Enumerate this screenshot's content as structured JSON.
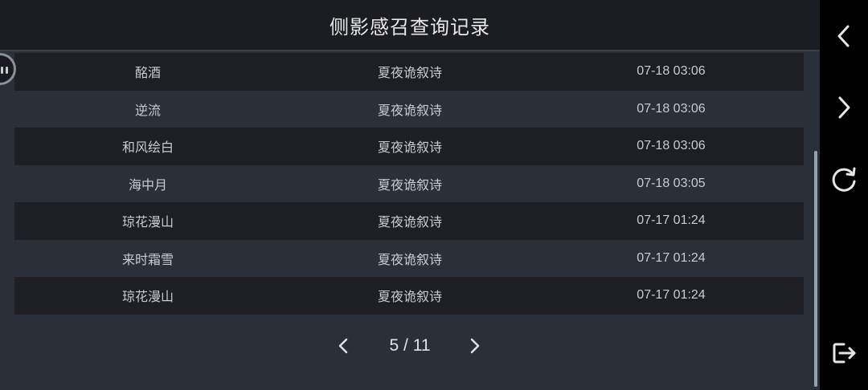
{
  "header": {
    "title": "侧影感召查询记录"
  },
  "records": [
    {
      "name": "酩酒",
      "group": "夏夜诡叙诗",
      "time": "07-18 03:06"
    },
    {
      "name": "逆流",
      "group": "夏夜诡叙诗",
      "time": "07-18 03:06"
    },
    {
      "name": "和风绘白",
      "group": "夏夜诡叙诗",
      "time": "07-18 03:06"
    },
    {
      "name": "海中月",
      "group": "夏夜诡叙诗",
      "time": "07-18 03:05"
    },
    {
      "name": "琼花漫山",
      "group": "夏夜诡叙诗",
      "time": "07-17 01:24"
    },
    {
      "name": "来时霜雪",
      "group": "夏夜诡叙诗",
      "time": "07-17 01:24"
    },
    {
      "name": "琼花漫山",
      "group": "夏夜诡叙诗",
      "time": "07-17 01:24"
    }
  ],
  "pagination": {
    "current": "5",
    "separator": "/",
    "total": "11"
  },
  "sidebar": {
    "buttons": [
      "back-icon",
      "forward-icon",
      "refresh-icon",
      "exit-icon"
    ]
  },
  "colors": {
    "background": "#2b2f38",
    "row_dark": "#1e1f25",
    "header": "#1c1d22",
    "text": "#c9cbd0",
    "sidebar": "#000000"
  }
}
